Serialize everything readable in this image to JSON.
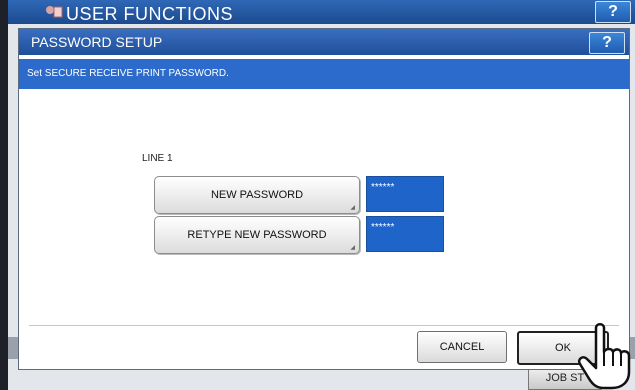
{
  "app": {
    "title": "USER FUNCTIONS",
    "help_label": "?",
    "job_status_label": "JOB ST"
  },
  "dialog": {
    "title": "PASSWORD SETUP",
    "help_label": "?",
    "message": "Set SECURE RECEIVE PRINT PASSWORD.",
    "line_label": "LINE 1",
    "new_password": {
      "label": "NEW PASSWORD",
      "value": "******"
    },
    "retype_password": {
      "label": "RETYPE NEW PASSWORD",
      "value": "******"
    },
    "cancel_label": "CANCEL",
    "ok_label": "OK"
  },
  "colors": {
    "header_blue": "#2f68b6",
    "subbar_blue": "#2c6bcc",
    "field_blue": "#1f64c8"
  },
  "icons": [
    "user-functions-logo-icon",
    "pointing-hand-cursor-icon",
    "help-icon"
  ]
}
